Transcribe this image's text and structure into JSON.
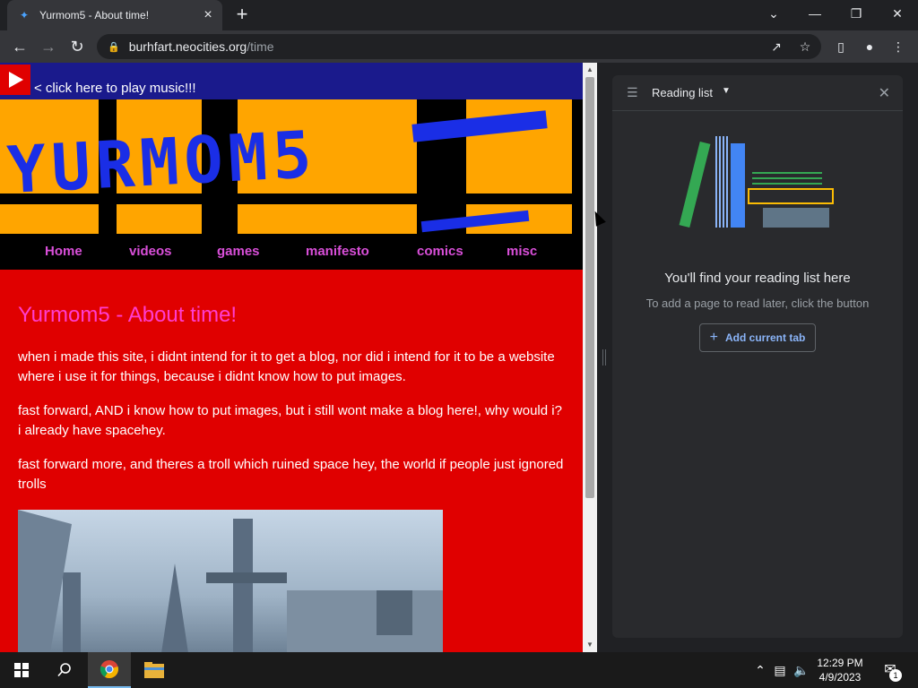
{
  "browser": {
    "tab_title": "Yurmom5 - About time!",
    "url_host": "burhfart.neocities.org",
    "url_path": "/time"
  },
  "page": {
    "music_link": "< click here to play music!!!",
    "banner_text": "YURMOM5",
    "nav": [
      "Home",
      "videos",
      "games",
      "manifesto",
      "comics",
      "misc"
    ],
    "heading": "Yurmom5 - About time!",
    "paragraphs": [
      "when i made this site, i didnt intend for it to get a blog, nor did i intend for it to be a website where i use it for things, because i didnt know how to put images.",
      "fast forward, AND i know how to put images, but i still wont make a blog here!, why would i? i already have spacehey.",
      "fast forward more, and theres a troll which ruined space hey, the world if people just ignored trolls"
    ]
  },
  "reading_list": {
    "title": "Reading list",
    "empty_title": "You'll find your reading list here",
    "empty_subtitle": "To add a page to read later, click the button",
    "add_button": "Add current tab"
  },
  "taskbar": {
    "time": "12:29 PM",
    "date": "4/9/2023",
    "notification_count": "1"
  },
  "colors": {
    "page_bg": "#e00000",
    "heading": "#ff3dd0",
    "nav_link": "#d94fd9",
    "banner_orange": "#ffa500",
    "banner_blue": "#1a2ee6"
  }
}
